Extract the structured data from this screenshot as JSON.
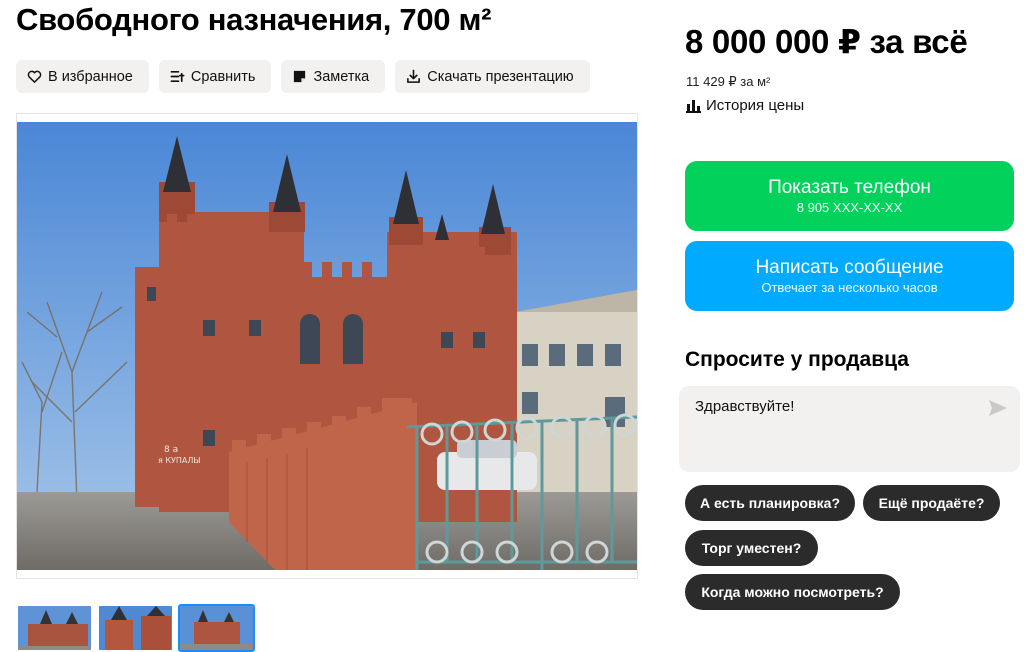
{
  "listing": {
    "title": "Свободного назначения, 700 м²"
  },
  "actions": [
    {
      "label": "В избранное",
      "icon": "heart-icon"
    },
    {
      "label": "Сравнить",
      "icon": "compare-icon"
    },
    {
      "label": "Заметка",
      "icon": "note-icon"
    },
    {
      "label": "Скачать презентацию",
      "icon": "download-icon"
    }
  ],
  "gallery": {
    "main_photo_caption": "8 а я КУПАЛЫ",
    "thumbnail_count": 3,
    "active_thumbnail": 3
  },
  "price": {
    "total": "8 000 000 ₽ за всё",
    "per_m2": "11 429 ₽ за м²",
    "history_label": "История цены"
  },
  "contact": {
    "phone_label": "Показать телефон",
    "phone_masked": "8 905 XXX-XX-XX",
    "message_label": "Написать сообщение",
    "message_sub": "Отвечает за несколько часов"
  },
  "ask": {
    "title": "Спросите у продавца",
    "input_value": "Здравствуйте!",
    "chips": [
      "А есть планировка?",
      "Ещё продаёте?",
      "Торг уместен?",
      "Когда можно посмотреть?"
    ]
  },
  "colors": {
    "phone_button": "#02d15c",
    "message_button": "#00aaff",
    "chip_background": "#2b2b2b",
    "action_background": "#f2f1f0",
    "active_thumbnail_border": "#1a8cff"
  }
}
